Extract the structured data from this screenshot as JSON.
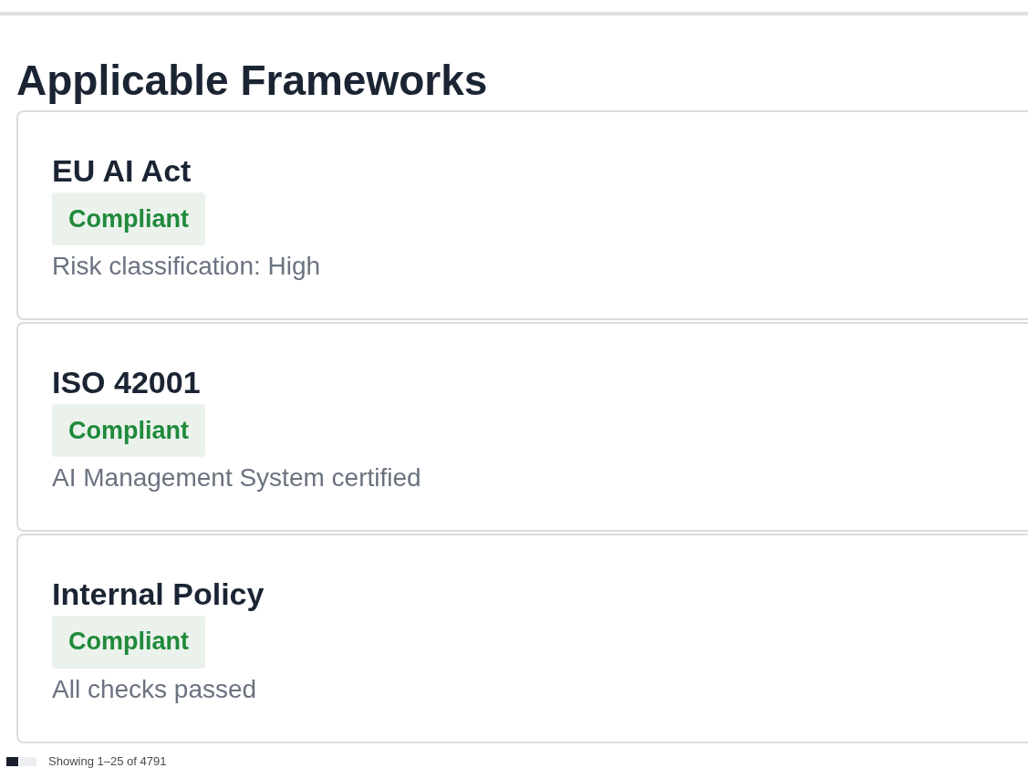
{
  "section": {
    "title": "Applicable Frameworks"
  },
  "frameworks": [
    {
      "name": "EU AI Act",
      "status": "Compliant",
      "detail": "Risk classification: High"
    },
    {
      "name": "ISO 42001",
      "status": "Compliant",
      "detail": "AI Management System certified"
    },
    {
      "name": "Internal Policy",
      "status": "Compliant",
      "detail": "All checks passed"
    }
  ],
  "footer": {
    "summary": "Showing 1–25 of 4791"
  }
}
